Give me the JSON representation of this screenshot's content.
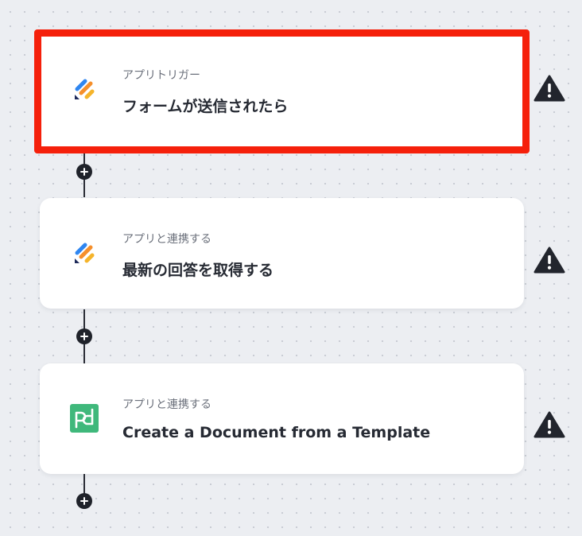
{
  "steps": [
    {
      "kind": "アプリトリガー",
      "title": "フォームが送信されたら",
      "app_icon": "form-app-icon",
      "status_icon": "warning-icon",
      "selected": true
    },
    {
      "kind": "アプリと連携する",
      "title": "最新の回答を取得する",
      "app_icon": "form-app-icon",
      "status_icon": "warning-icon",
      "selected": false
    },
    {
      "kind": "アプリと連携する",
      "title": "Create a Document from a Template",
      "app_icon": "pandadoc-icon",
      "status_icon": "warning-icon",
      "selected": false
    }
  ],
  "add_node_icon": "plus-icon",
  "colors": {
    "selection_border": "#f5200b",
    "warning": "#22252d",
    "connector": "#2a2d36",
    "pandadoc_green": "#3fb87b",
    "form_blue": "#2f86f0",
    "form_orange": "#f58f2b",
    "form_navy": "#1e2a5a"
  }
}
